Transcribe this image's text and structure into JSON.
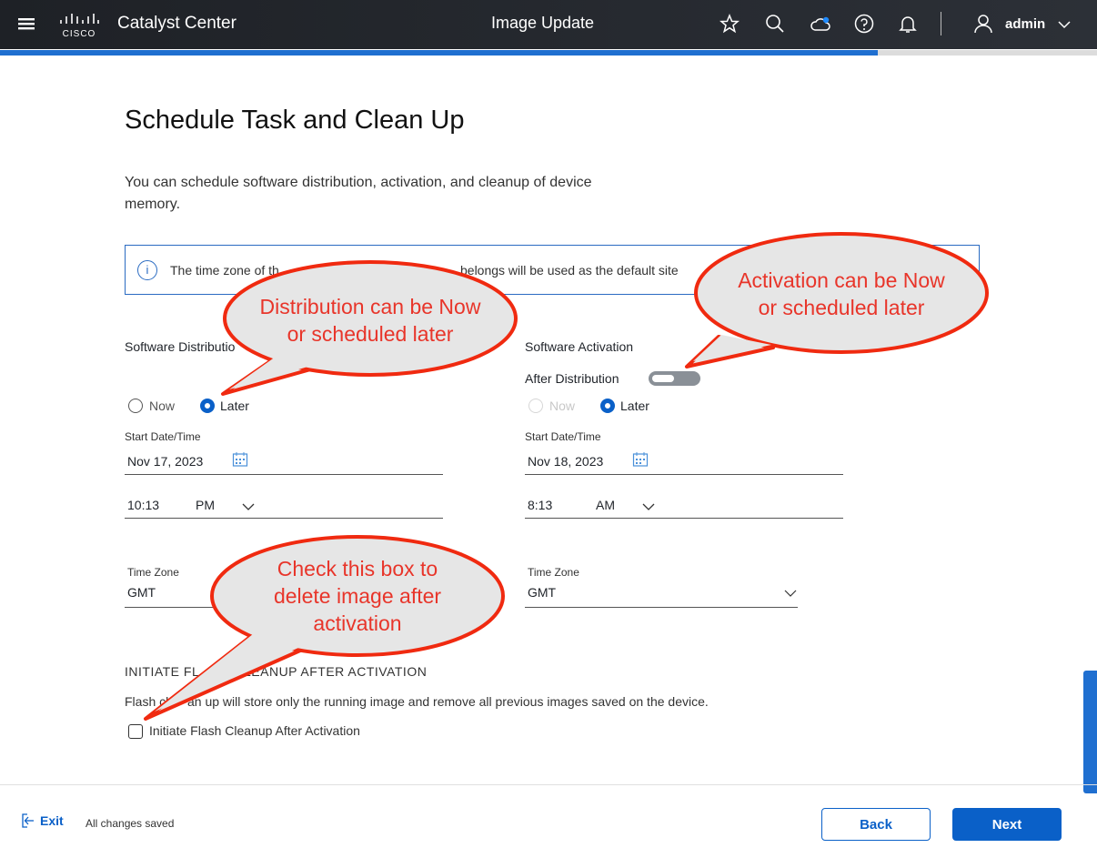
{
  "header": {
    "app_title": "Catalyst Center",
    "page_title": "Image Update",
    "user": "admin",
    "logo_text": "cisco",
    "icons": [
      "menu-icon",
      "star-icon",
      "search-icon",
      "cloud-icon",
      "help-icon",
      "bell-icon",
      "user-icon",
      "chevron-down-icon"
    ]
  },
  "progress": {
    "percent": 80
  },
  "main": {
    "title": "Schedule Task and Clean Up",
    "description_line1": "You can schedule software distribution, activation, and cleanup of device",
    "description_line2": "memory.",
    "info_text_a": "The time zone of th",
    "info_text_b": "belongs will be used as the default site",
    "distribution": {
      "label": "Software Distributio",
      "now": "Now",
      "later": "Later",
      "selected": "Later",
      "start_label": "Start Date/Time",
      "date": "Nov 17, 2023",
      "time": "10:13",
      "ampm": "PM",
      "tz_label": "Time Zone",
      "tz": "GMT"
    },
    "activation": {
      "label": "Software Activation",
      "after_label": "After Distribution",
      "after_on": false,
      "now": "Now",
      "later": "Later",
      "selected": "Later",
      "start_label": "Start Date/Time",
      "date": "Nov 18, 2023",
      "time": "8:13",
      "ampm": "AM",
      "tz_label": "Time Zone",
      "tz": "GMT"
    },
    "cleanup": {
      "heading_a": "INITIATE FL",
      "heading_b": "LEANUP AFTER ACTIVATION",
      "desc_a": "Flash cl",
      "desc_b": "an up will store only the running image and remove all previous images saved on the device.",
      "checkbox_label": "Initiate Flash Cleanup After Activation",
      "checked": false
    }
  },
  "callouts": [
    {
      "line1": "Distribution can be Now",
      "line2": "or scheduled later"
    },
    {
      "line1": "Activation can be Now",
      "line2": "or scheduled later"
    },
    {
      "line1": "Check this box to",
      "line2": "delete image after",
      "line3": "activation"
    }
  ],
  "footer": {
    "exit": "Exit",
    "status": "All changes saved",
    "back": "Back",
    "next": "Next"
  },
  "colors": {
    "primary": "#0a60c8",
    "callout_stroke": "#f02a10",
    "callout_text": "#e8352a"
  }
}
